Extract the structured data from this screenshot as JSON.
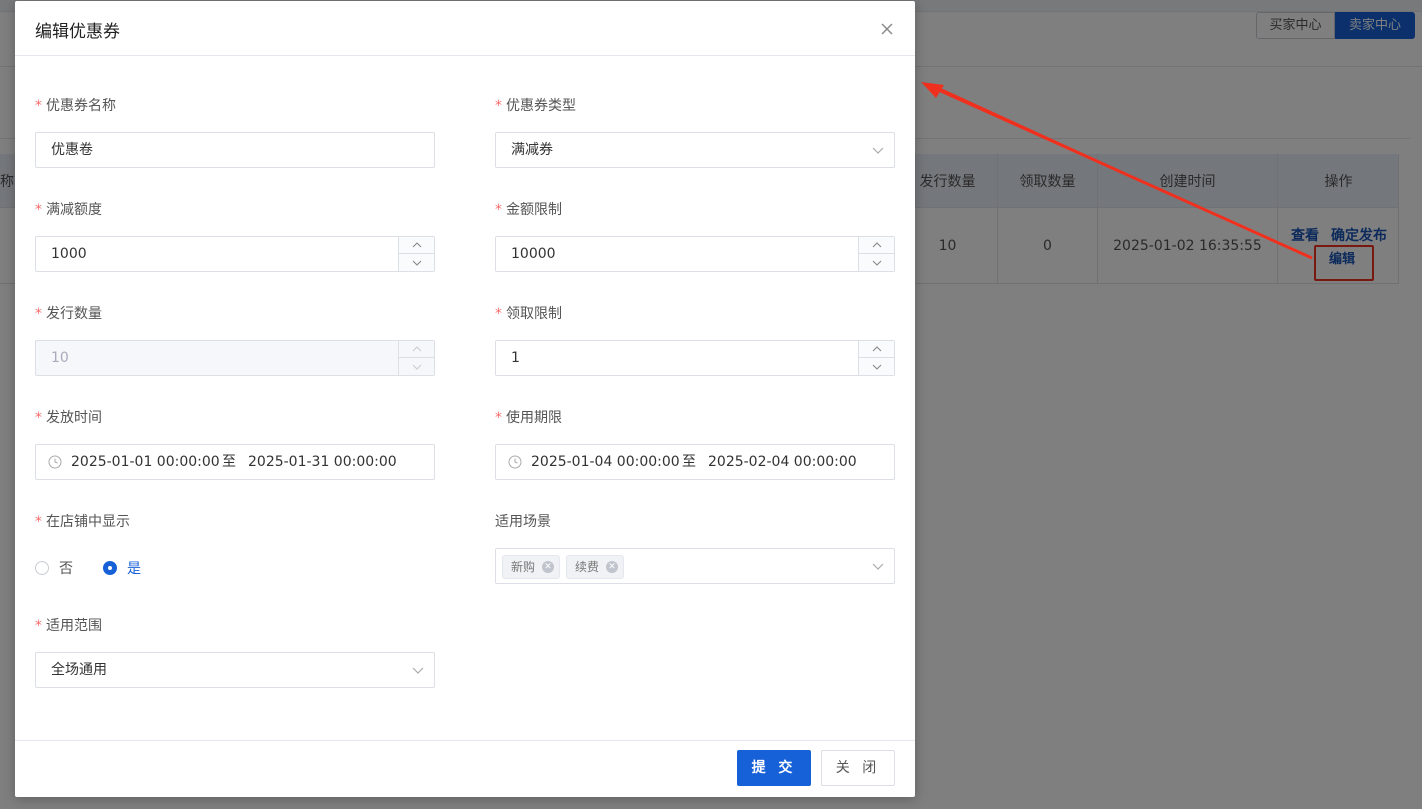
{
  "background": {
    "header_buttons": {
      "buyer_center": "买家中心",
      "seller_center": "卖家中心"
    },
    "table": {
      "partial_header_left": "称",
      "columns": [
        "发行数量",
        "领取数量",
        "创建时间",
        "操作"
      ],
      "row": {
        "issued": "10",
        "claimed": "0",
        "created_at": "2025-01-02 16:35:55",
        "actions": {
          "view": "查看",
          "publish": "确定发布",
          "edit": "编辑"
        }
      }
    },
    "annotation": {
      "highlight_color": "#f0301e"
    }
  },
  "dialog": {
    "title": "编辑优惠券",
    "close_icon": "close-icon",
    "fields": {
      "coupon_name": {
        "label": "优惠券名称",
        "value": "优惠卷"
      },
      "coupon_type": {
        "label": "优惠券类型",
        "value": "满减券"
      },
      "discount_amount": {
        "label": "满减额度",
        "value": "1000"
      },
      "amount_limit": {
        "label": "金额限制",
        "value": "10000"
      },
      "issue_quantity": {
        "label": "发行数量",
        "value": "10"
      },
      "claim_limit": {
        "label": "领取限制",
        "value": "1"
      },
      "issue_time": {
        "label": "发放时间",
        "start": "2025-01-01 00:00:00",
        "separator": "至",
        "end": "2025-01-31 00:00:00"
      },
      "valid_period": {
        "label": "使用期限",
        "start": "2025-01-04 00:00:00",
        "separator": "至",
        "end": "2025-02-04 00:00:00"
      },
      "show_in_store": {
        "label": "在店铺中显示",
        "options": [
          "否",
          "是"
        ],
        "selected": "是"
      },
      "scenarios": {
        "label": "适用场景",
        "tags": [
          "新购",
          "续费"
        ]
      },
      "scope": {
        "label": "适用范围",
        "value": "全场通用"
      }
    },
    "footer": {
      "submit": "提 交",
      "close": "关 闭"
    }
  },
  "colors": {
    "primary": "#1761d8",
    "required": "#f56c6c",
    "overlay": "rgba(0,0,0,0.5)"
  }
}
